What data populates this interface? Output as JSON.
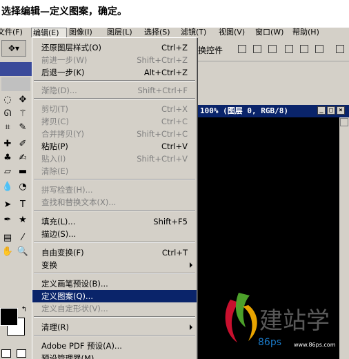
{
  "caption": "选择编辑—定义图案，确定。",
  "menubar": [
    {
      "label": "文件(F)"
    },
    {
      "label": "编辑(E)"
    },
    {
      "label": "图像(I)"
    },
    {
      "label": "图层(L)"
    },
    {
      "label": "选择(S)"
    },
    {
      "label": "滤镜(T)"
    },
    {
      "label": "视图(V)"
    },
    {
      "label": "窗口(W)"
    },
    {
      "label": "帮助(H)"
    }
  ],
  "options_bar": {
    "transform_label": "换控件"
  },
  "document": {
    "title": "100% (图层 0, RGB/8)",
    "watermark_text": "86ps",
    "watermark_url": "www.86ps.com"
  },
  "edit_menu": {
    "items": [
      {
        "label": "还原图层样式(O)",
        "shortcut": "Ctrl+Z"
      },
      {
        "label": "前进一步(W)",
        "shortcut": "Shift+Ctrl+Z"
      },
      {
        "label": "后退一步(K)",
        "shortcut": "Alt+Ctrl+Z"
      },
      {
        "label": "渐隐(D)...",
        "shortcut": "Shift+Ctrl+F"
      },
      {
        "label": "剪切(T)",
        "shortcut": "Ctrl+X"
      },
      {
        "label": "拷贝(C)",
        "shortcut": "Ctrl+C"
      },
      {
        "label": "合并拷贝(Y)",
        "shortcut": "Shift+Ctrl+C"
      },
      {
        "label": "粘贴(P)",
        "shortcut": "Ctrl+V"
      },
      {
        "label": "贴入(I)",
        "shortcut": "Shift+Ctrl+V"
      },
      {
        "label": "清除(E)",
        "shortcut": ""
      },
      {
        "label": "拼写检查(H)...",
        "shortcut": ""
      },
      {
        "label": "查找和替换文本(X)...",
        "shortcut": ""
      },
      {
        "label": "填充(L)...",
        "shortcut": "Shift+F5"
      },
      {
        "label": "描边(S)...",
        "shortcut": ""
      },
      {
        "label": "自由变换(F)",
        "shortcut": "Ctrl+T"
      },
      {
        "label": "变换",
        "shortcut": ""
      },
      {
        "label": "定义画笔预设(B)...",
        "shortcut": ""
      },
      {
        "label": "定义图案(Q)...",
        "shortcut": ""
      },
      {
        "label": "定义自定形状(V)...",
        "shortcut": ""
      },
      {
        "label": "清理(R)",
        "shortcut": ""
      },
      {
        "label": "Adobe PDF 预设(A)...",
        "shortcut": ""
      },
      {
        "label": "预设管理器(M)...",
        "shortcut": ""
      }
    ]
  },
  "tool_icons": [
    "move-icon",
    "marquee-icon",
    "lasso-icon",
    "magic-wand-icon",
    "crop-icon",
    "slice-icon",
    "heal-icon",
    "brush-icon",
    "stamp-icon",
    "history-brush-icon",
    "eraser-icon",
    "gradient-icon",
    "blur-icon",
    "dodge-icon",
    "path-select-icon",
    "type-icon",
    "pen-icon",
    "shape-icon",
    "notes-icon",
    "eyedropper-icon",
    "hand-icon",
    "zoom-icon"
  ]
}
